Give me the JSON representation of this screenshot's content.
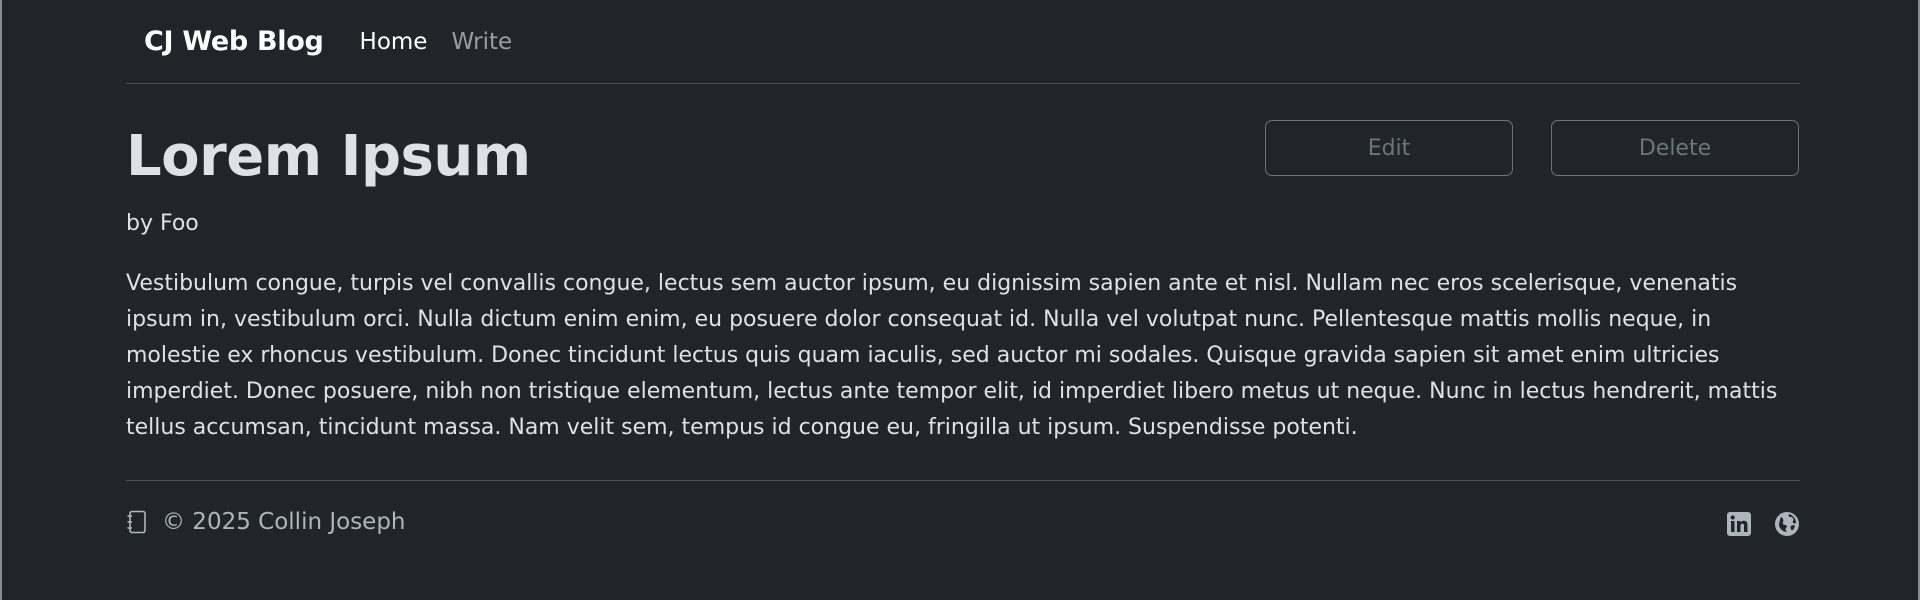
{
  "navbar": {
    "brand": "CJ Web Blog",
    "links": [
      {
        "label": "Home",
        "active": true
      },
      {
        "label": "Write",
        "active": false
      }
    ]
  },
  "post": {
    "title": "Lorem Ipsum",
    "byline": "by Foo",
    "body": "Vestibulum congue, turpis vel convallis congue, lectus sem auctor ipsum, eu dignissim sapien ante et nisl. Nullam nec eros scelerisque, venenatis ipsum in, vestibulum orci. Nulla dictum enim enim, eu posuere dolor consequat id. Nulla vel volutpat nunc. Pellentesque mattis mollis neque, in molestie ex rhoncus vestibulum. Donec tincidunt lectus quis quam iaculis, sed auctor mi sodales. Quisque gravida sapien sit amet enim ultricies imperdiet. Donec posuere, nibh non tristique elementum, lectus ante tempor elit, id imperdiet libero metus ut neque. Nunc in lectus hendrerit, mattis tellus accumsan, tincidunt massa. Nam velit sem, tempus id congue eu, fringilla ut ipsum. Suspendisse potenti."
  },
  "actions": {
    "edit_label": "Edit",
    "delete_label": "Delete"
  },
  "footer": {
    "copyright": "© 2025 Collin Joseph",
    "icons": [
      "journal-icon",
      "linkedin-icon",
      "globe-icon"
    ]
  },
  "colors": {
    "background": "#212529",
    "text": "#dee2e6",
    "muted": "#6c757d",
    "border": "#495057"
  }
}
